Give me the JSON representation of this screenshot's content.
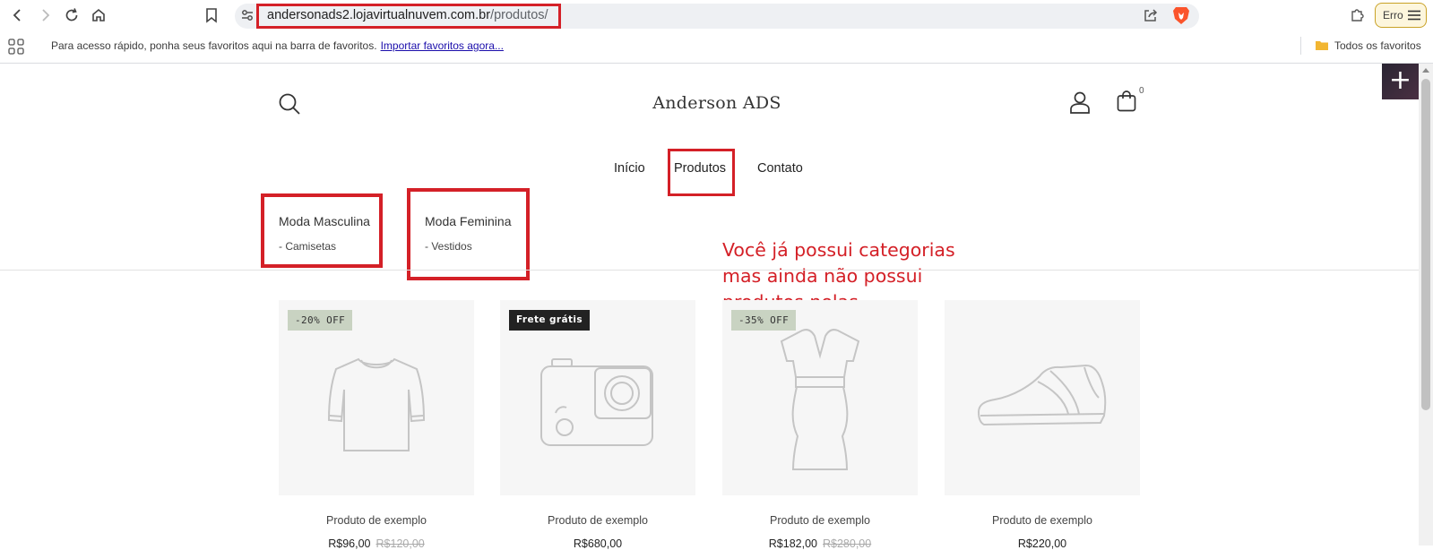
{
  "browser": {
    "url_host": "andersonads2.lojavirtualnuvem.com.br",
    "url_path": "/produtos/",
    "error_label": "Erro",
    "bookmarks_bar": {
      "hint": "Para acesso rápido, ponha seus favoritos aqui na barra de favoritos.",
      "import_link": "Importar favoritos agora...",
      "all_bookmarks": "Todos os favoritos"
    }
  },
  "store": {
    "title": "Anderson ADS",
    "cart_count": "0",
    "admin_add": "+"
  },
  "menu": {
    "items": [
      "Início",
      "Produtos",
      "Contato"
    ]
  },
  "categories": [
    {
      "name": "Moda Masculina",
      "sub": "- Camisetas"
    },
    {
      "name": "Moda Feminina",
      "sub": "- Vestidos"
    }
  ],
  "annotation": {
    "lines": [
      "Você já possui categorias",
      "mas ainda não possui",
      "produtos nelas..."
    ],
    "color": "#d42027"
  },
  "products": [
    {
      "badge": "-20% OFF",
      "icon": "tshirt-icon",
      "name": "Produto de exemplo",
      "price": "R$96,00",
      "old_price": "R$120,00"
    },
    {
      "badge": "Frete grátis",
      "icon": "camera-icon",
      "name": "Produto de exemplo",
      "price": "R$680,00",
      "old_price": ""
    },
    {
      "badge": "-35% OFF",
      "icon": "dress-icon",
      "name": "Produto de exemplo",
      "price": "R$182,00",
      "old_price": "R$280,00"
    },
    {
      "badge": "",
      "icon": "sneaker-icon",
      "name": "Produto de exemplo",
      "price": "R$220,00",
      "old_price": ""
    }
  ]
}
